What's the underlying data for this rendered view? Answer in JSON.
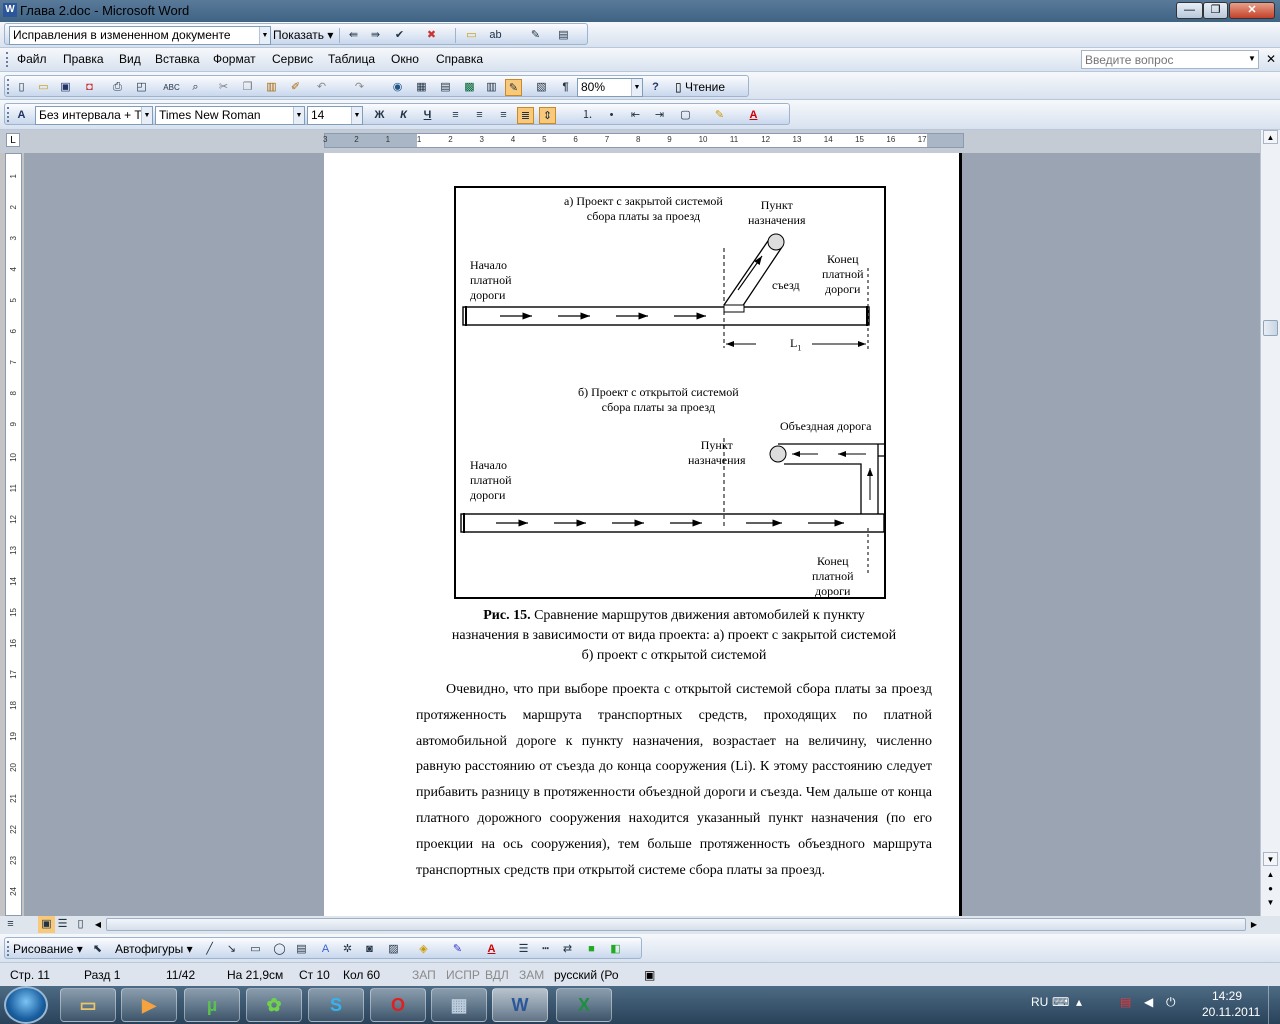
{
  "window": {
    "title": "Глава 2.doc - Microsoft Word",
    "minimize": "—",
    "restore": "❐",
    "close": "✕"
  },
  "reviewing_toolbar": {
    "track_changes_mode": "Исправления в измененном документе",
    "show_label": "Показать"
  },
  "menu": {
    "items": [
      "Файл",
      "Правка",
      "Вид",
      "Вставка",
      "Формат",
      "Сервис",
      "Таблица",
      "Окно",
      "Справка"
    ],
    "help_placeholder": "Введите вопрос"
  },
  "standard_toolbar": {
    "zoom": "80%",
    "reading_label": "Чтение"
  },
  "formatting_toolbar": {
    "style": "Без интервала + Т",
    "font": "Times New Roman",
    "size": "14",
    "bold": "Ж",
    "italic": "К",
    "underline": "Ч"
  },
  "ruler": {
    "h_ticks": [
      "3",
      "2",
      "1",
      "1",
      "2",
      "3",
      "4",
      "5",
      "6",
      "7",
      "8",
      "9",
      "10",
      "11",
      "12",
      "13",
      "14",
      "15",
      "16",
      "17"
    ],
    "v_ticks": [
      "1",
      "2",
      "3",
      "4",
      "5",
      "6",
      "7",
      "8",
      "9",
      "10",
      "11",
      "12",
      "13",
      "14",
      "15",
      "16",
      "17",
      "18",
      "19",
      "20",
      "21",
      "22",
      "23",
      "24"
    ],
    "corner": "L"
  },
  "figure": {
    "title_a_line1": "а) Проект с закрытой системой",
    "title_a_line2": "сбора платы за проезд",
    "dest_a_line1": "Пункт",
    "dest_a_line2": "назначения",
    "start_a_line1": "Начало",
    "start_a_line2": "платной",
    "start_a_line3": "дороги",
    "exit_a": "съезд",
    "end_a_line1": "Конец",
    "end_a_line2": "платной",
    "end_a_line3": "дороги",
    "distance_label": "L",
    "distance_sub": "1",
    "title_b_line1": "б) Проект с открытой системой",
    "title_b_line2": "сбора платы за проезд",
    "bypass_b": "Объездная дорога",
    "dest_b_line1": "Пункт",
    "dest_b_line2": "назначения",
    "start_b_line1": "Начало",
    "start_b_line2": "платной",
    "start_b_line3": "дороги",
    "end_b_line1": "Конец",
    "end_b_line2": "платной",
    "end_b_line3": "дороги"
  },
  "caption": {
    "bold_prefix": "Рис. 15.",
    "line1": " Сравнение маршрутов движения автомобилей к пункту",
    "line2": "назначения в зависимости от вида проекта: а) проект с закрытой системой",
    "line3": "б) проект с открытой системой"
  },
  "body_text": "Очевидно, что при выборе проекта с открытой системой сбора платы за проезд протяженность маршрута транспортных средств, проходящих по платной автомобильной дороге к пункту назначения, возрастает на величину, численно равную расстоянию от съезда до конца сооружения (Li). К этому расстоянию следует прибавить разницу в протяженности объездной дороги и съезда. Чем дальше от конца платного дорожного сооружения находится указанный пункт назначения (по его проекции на ось сооружения), тем больше протяженность объездного маршрута транспортных средств при открытой системе сбора платы за проезд.",
  "drawing_toolbar": {
    "drawing_label": "Рисование",
    "autoshapes_label": "Автофигуры"
  },
  "status_bar": {
    "page": "Стр.  11",
    "section": "Разд  1",
    "pages": "11/42",
    "at": "На  21,9см",
    "line": "Ст  10",
    "col": "Кол  60",
    "rec": "ЗАП",
    "trk": "ИСПР",
    "ext": "ВДЛ",
    "ovr": "ЗАМ",
    "language": "русский (Ро"
  },
  "taskbar": {
    "apps": [
      "explorer",
      "media-player",
      "utorrent",
      "icq",
      "skype",
      "opera",
      "calculator",
      "word",
      "excel"
    ],
    "lang": "RU",
    "time": "14:29",
    "date": "20.11.2011"
  }
}
